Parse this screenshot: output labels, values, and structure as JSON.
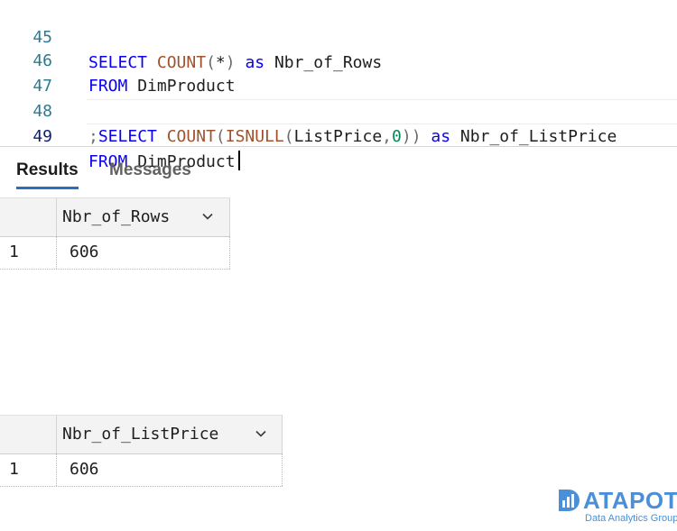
{
  "editor": {
    "lines": [
      {
        "num": "45",
        "tokens": [
          {
            "t": "SELECT",
            "c": "kw"
          },
          {
            "t": " ",
            "c": "ident"
          },
          {
            "t": "COUNT",
            "c": "fn"
          },
          {
            "t": "(",
            "c": "op"
          },
          {
            "t": "*",
            "c": "ident"
          },
          {
            "t": ")",
            "c": "op"
          },
          {
            "t": " ",
            "c": "ident"
          },
          {
            "t": "as",
            "c": "kw"
          },
          {
            "t": " Nbr_of_Rows",
            "c": "ident"
          }
        ]
      },
      {
        "num": "46",
        "tokens": [
          {
            "t": "FROM",
            "c": "kw"
          },
          {
            "t": " DimProduct",
            "c": "ident"
          }
        ]
      },
      {
        "num": "47",
        "tokens": []
      },
      {
        "num": "48",
        "tokens": [
          {
            "t": ";",
            "c": "op"
          },
          {
            "t": "SELECT",
            "c": "kw"
          },
          {
            "t": " ",
            "c": "ident"
          },
          {
            "t": "COUNT",
            "c": "fn"
          },
          {
            "t": "(",
            "c": "op"
          },
          {
            "t": "ISNULL",
            "c": "fn"
          },
          {
            "t": "(",
            "c": "op"
          },
          {
            "t": "ListPrice",
            "c": "ident"
          },
          {
            "t": ",",
            "c": "op"
          },
          {
            "t": "0",
            "c": "num"
          },
          {
            "t": "))",
            "c": "op"
          },
          {
            "t": " ",
            "c": "ident"
          },
          {
            "t": "as",
            "c": "kw"
          },
          {
            "t": " Nbr_of_ListPrice",
            "c": "ident"
          }
        ]
      },
      {
        "num": "49",
        "tokens": [
          {
            "t": "FROM",
            "c": "kw"
          },
          {
            "t": " DimProduct",
            "c": "ident"
          }
        ]
      }
    ]
  },
  "tabs": {
    "results": "Results",
    "messages": "Messages"
  },
  "grid1": {
    "column": "Nbr_of_Rows",
    "row_number": "1",
    "value": "606"
  },
  "grid2": {
    "column": "Nbr_of_ListPrice",
    "row_number": "1",
    "value": "606"
  },
  "watermark": {
    "brand": "ATAPOT",
    "tagline": "Data Analytics Group",
    "color": "#4b8fd8"
  }
}
